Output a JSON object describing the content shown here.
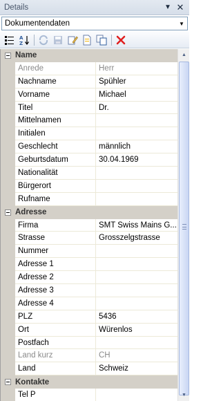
{
  "panel": {
    "title": "Details"
  },
  "selector": {
    "value": "Dokumentendaten"
  },
  "colors": {
    "delete": "#e02020",
    "accent": "#2f5d9e",
    "category_bg": "#d4d0c8"
  },
  "toolbar": {
    "icons": [
      "categorized-icon",
      "alphabetical-sort-icon",
      "refresh-icon",
      "save-icon",
      "edit-icon",
      "new-document-icon",
      "copy-icon",
      "delete-icon"
    ]
  },
  "categories": [
    {
      "label": "Name",
      "rows": [
        {
          "label": "Anrede",
          "value": "Herr"
        },
        {
          "label": "Nachname",
          "value": "Spühler"
        },
        {
          "label": "Vorname",
          "value": "Michael"
        },
        {
          "label": "Titel",
          "value": "Dr."
        },
        {
          "label": "Mittelnamen",
          "value": ""
        },
        {
          "label": "Initialen",
          "value": ""
        },
        {
          "label": "Geschlecht",
          "value": "männlich"
        },
        {
          "label": "Geburtsdatum",
          "value": "30.04.1969"
        },
        {
          "label": "Nationalität",
          "value": ""
        },
        {
          "label": "Bürgerort",
          "value": ""
        },
        {
          "label": "Rufname",
          "value": ""
        }
      ]
    },
    {
      "label": "Adresse",
      "rows": [
        {
          "label": "Firma",
          "value": "SMT Swiss Mains G..."
        },
        {
          "label": "Strasse",
          "value": "Grosszelgstrasse"
        },
        {
          "label": "Nummer",
          "value": ""
        },
        {
          "label": "Adresse 1",
          "value": ""
        },
        {
          "label": "Adresse 2",
          "value": ""
        },
        {
          "label": "Adresse 3",
          "value": ""
        },
        {
          "label": "Adresse 4",
          "value": ""
        },
        {
          "label": "PLZ",
          "value": "5436"
        },
        {
          "label": "Ort",
          "value": "Würenlos"
        },
        {
          "label": "Postfach",
          "value": ""
        },
        {
          "label": "Land kurz",
          "value": "CH"
        },
        {
          "label": "Land",
          "value": "Schweiz"
        }
      ]
    },
    {
      "label": "Kontakte",
      "rows": [
        {
          "label": "Tel P",
          "value": ""
        }
      ]
    }
  ]
}
